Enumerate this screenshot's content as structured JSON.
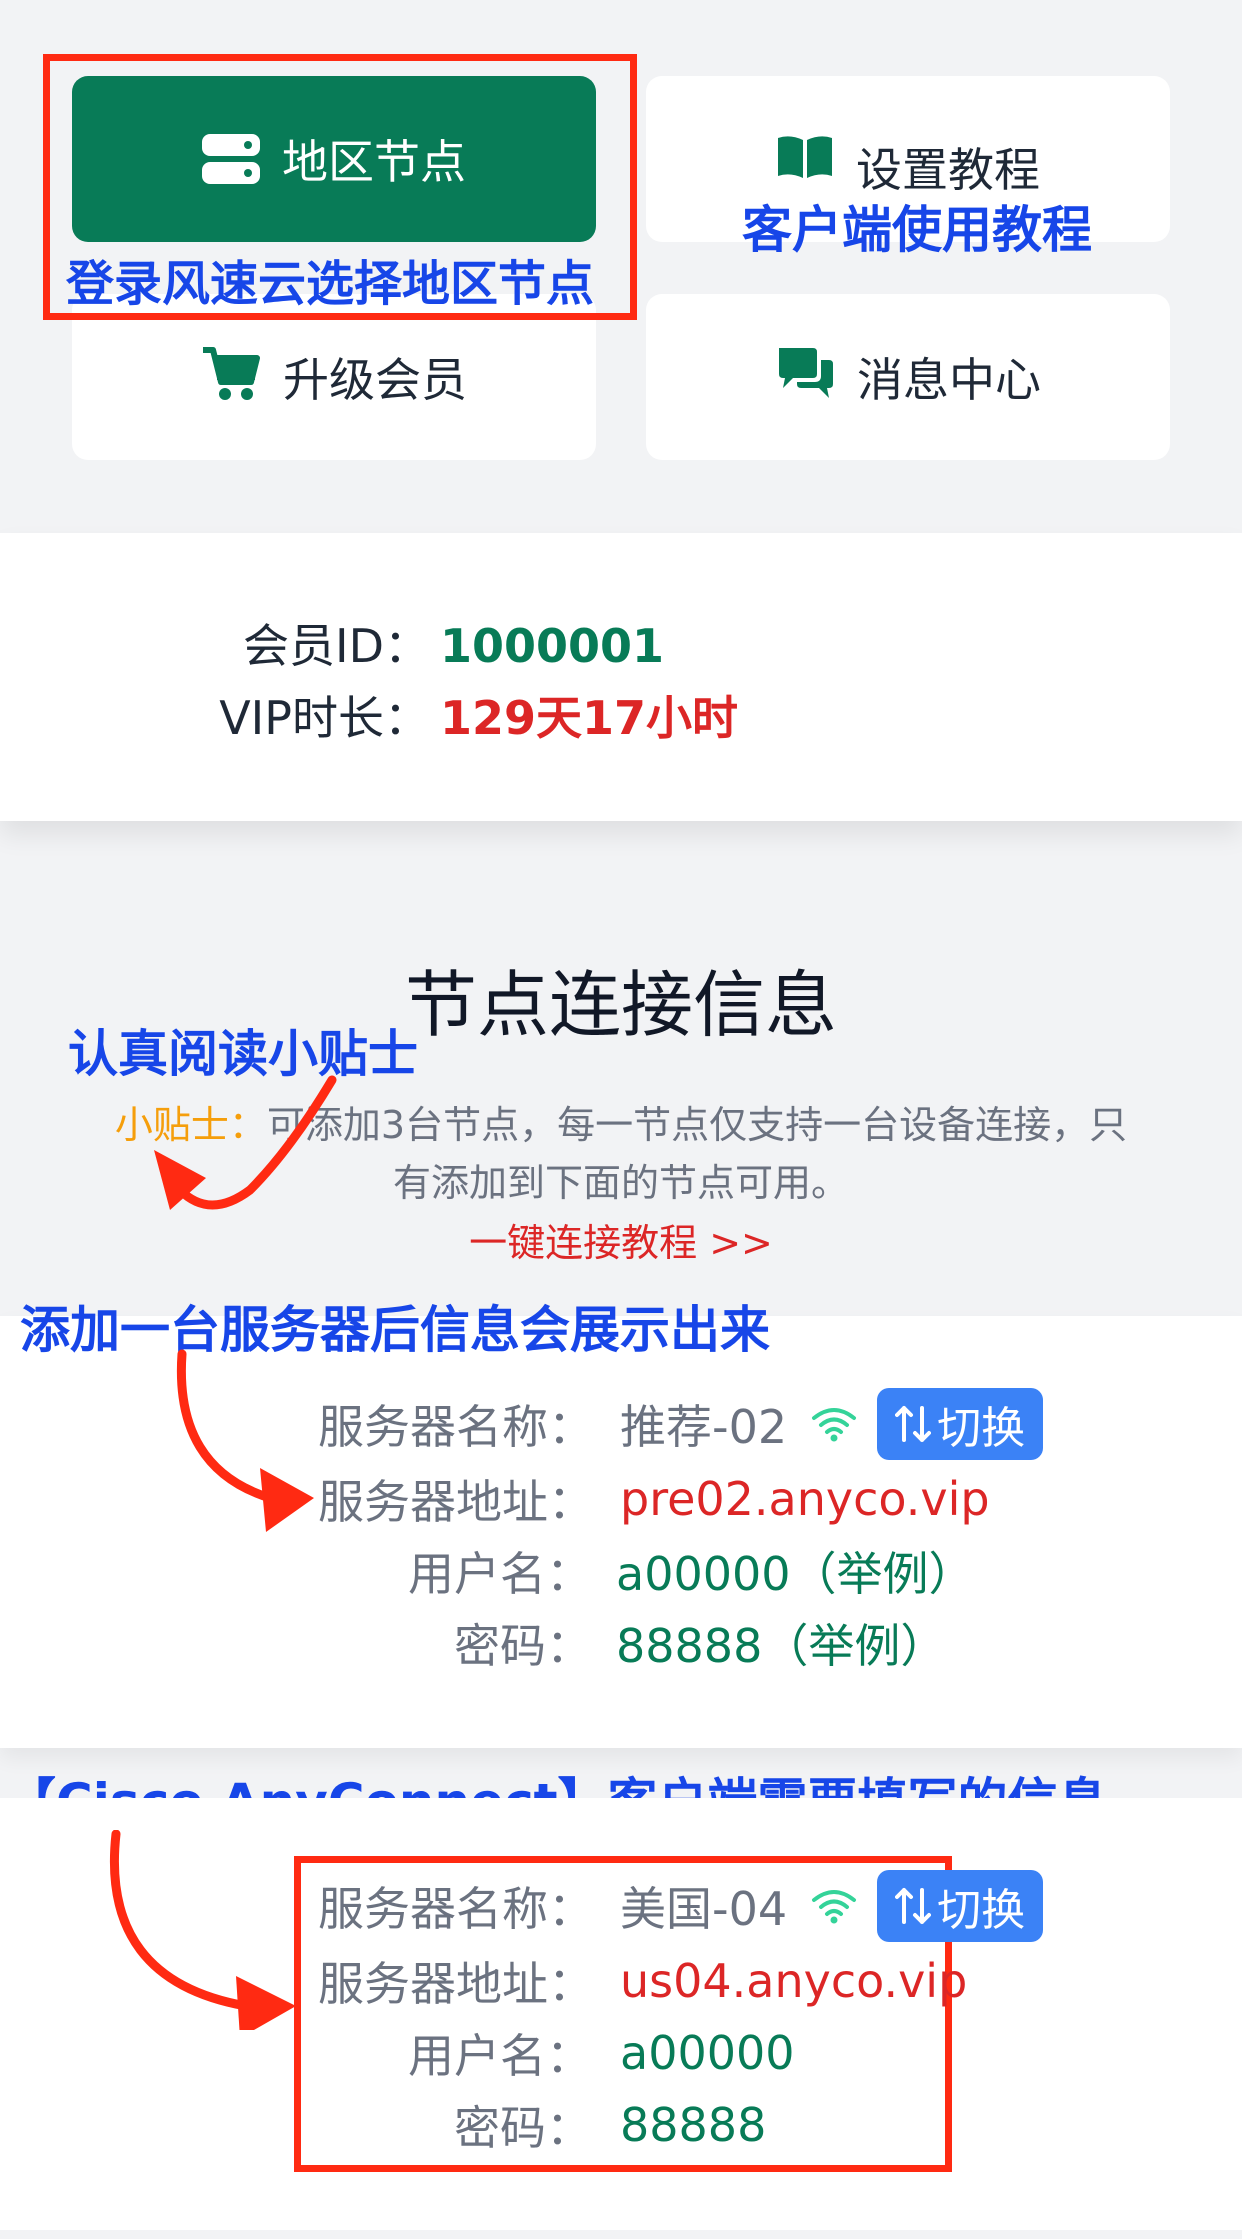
{
  "menu": {
    "region_nodes": "地区节点",
    "setup_tutorial": "设置教程",
    "upgrade_member": "升级会员",
    "message_center": "消息中心"
  },
  "annotations": {
    "login_select": "登录风速云选择地区节点",
    "client_tutorial": "客户端使用教程",
    "read_tips": "认真阅读小贴士",
    "info_shown": "添加一台服务器后信息会展示出来",
    "cisco_info": "【Cisco AnyConnect】客户端需要填写的信息"
  },
  "member": {
    "id_label": "会员ID：",
    "id_value": "1000001",
    "vip_label": "VIP时长：",
    "vip_value": "129天17小时"
  },
  "node_section": {
    "title": "节点连接信息",
    "tip_label": "小贴士：",
    "tip_text_line1": "可添加3台节点，每一节点仅支持一台设备连接，只",
    "tip_text_line2": "有添加到下面的节点可用。",
    "tutorial_link": "一键连接教程 >>"
  },
  "server_card_1": {
    "name_label": "服务器名称：",
    "name_value": "推荐-02",
    "address_label": "服务器地址：",
    "address_value": "pre02.anyco.vip",
    "user_label": "用户名：",
    "user_value": "a00000（举例）",
    "password_label": "密码：",
    "password_value": "88888（举例）",
    "switch_label": "切换"
  },
  "server_card_2": {
    "name_label": "服务器名称：",
    "name_value": "美国-04",
    "address_label": "服务器地址：",
    "address_value": "us04.anyco.vip",
    "user_label": "用户名：",
    "user_value": "a00000",
    "password_label": "密码：",
    "password_value": "88888",
    "switch_label": "切换"
  },
  "colors": {
    "primary_green": "#087b57",
    "annotation_blue": "#1746e8",
    "annotation_red": "#ff2a12",
    "value_red": "#dc2626",
    "switch_blue": "#3b82f6",
    "tip_orange": "#f59e0b"
  }
}
